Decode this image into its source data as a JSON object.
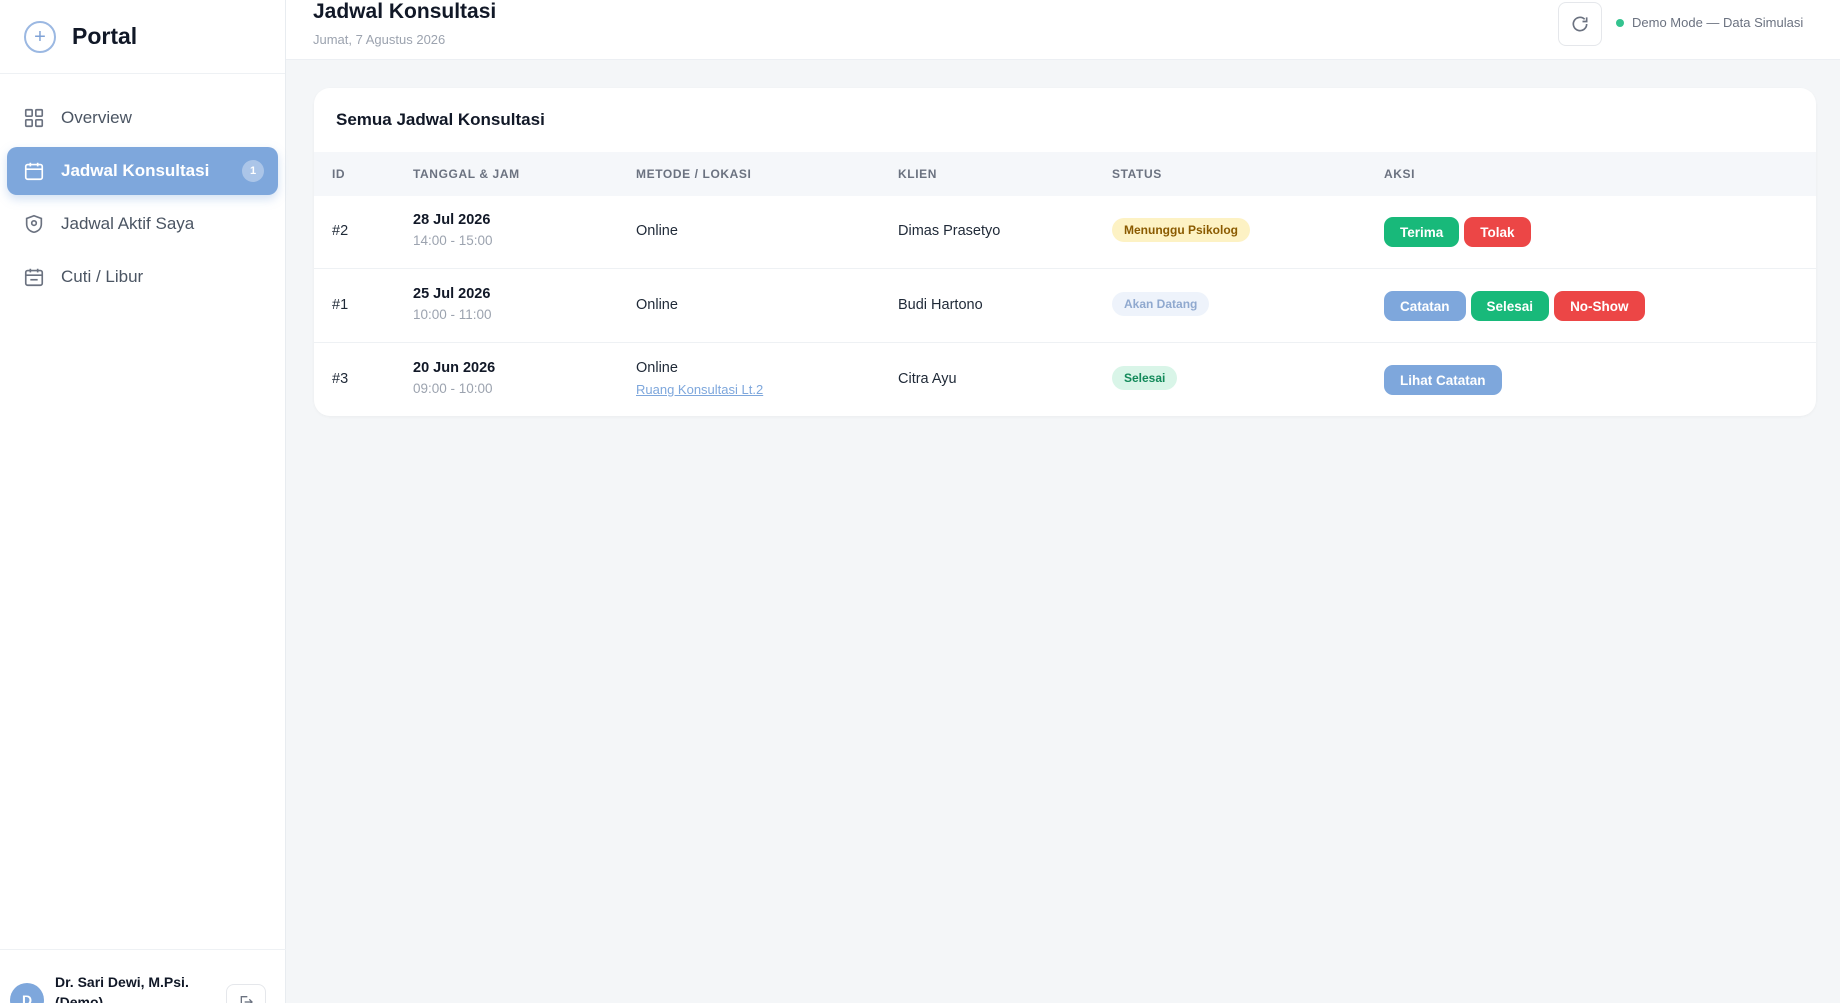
{
  "brand": {
    "name": "Portal",
    "icon": "plus-circle-icon"
  },
  "sidebar": {
    "items": [
      {
        "label": "Overview",
        "icon": "grid-icon"
      },
      {
        "label": "Jadwal Konsultasi",
        "icon": "calendar-icon",
        "badge": "1",
        "active": true
      },
      {
        "label": "Jadwal Aktif Saya",
        "icon": "shield-icon"
      },
      {
        "label": "Cuti / Libur",
        "icon": "calendar-icon"
      }
    ],
    "user": {
      "initial": "D",
      "name": "Dr. Sari Dewi, M.Psi. (Demo)"
    }
  },
  "header": {
    "title": "Jadwal Konsultasi",
    "date": "Jumat, 7 Agustus 2026",
    "demo_status": "Demo Mode — Data Simulasi"
  },
  "card": {
    "title": "Semua Jadwal Konsultasi",
    "columns": [
      "ID",
      "TANGGAL & JAM",
      "METODE / LOKASI",
      "KLIEN",
      "STATUS",
      "AKSI"
    ],
    "rows": [
      {
        "id": "#2",
        "date": "28 Jul 2026",
        "time": "14:00 - 15:00",
        "method": "Online",
        "location": "",
        "client": "Dimas Prasetyo",
        "status": "Menunggu Psikolog",
        "actions": [
          "Terima",
          "Tolak"
        ]
      },
      {
        "id": "#1",
        "date": "25 Jul 2026",
        "time": "10:00 - 11:00",
        "method": "Online",
        "location": "",
        "client": "Budi Hartono",
        "status": "Akan Datang",
        "actions": [
          "Catatan",
          "Selesai",
          "No-Show"
        ]
      },
      {
        "id": "#3",
        "date": "20 Jun 2026",
        "time": "09:00 - 10:00",
        "method": "Online",
        "location": "Ruang Konsultasi Lt.2",
        "client": "Citra Ayu",
        "status": "Selesai",
        "actions": [
          "Lihat Catatan"
        ]
      }
    ]
  },
  "colors": {
    "accent": "#7ea7dc",
    "success": "#18b97a",
    "danger": "#ec4646",
    "warning_bg": "#fdf2c4",
    "demo_dot": "#34c38f"
  }
}
